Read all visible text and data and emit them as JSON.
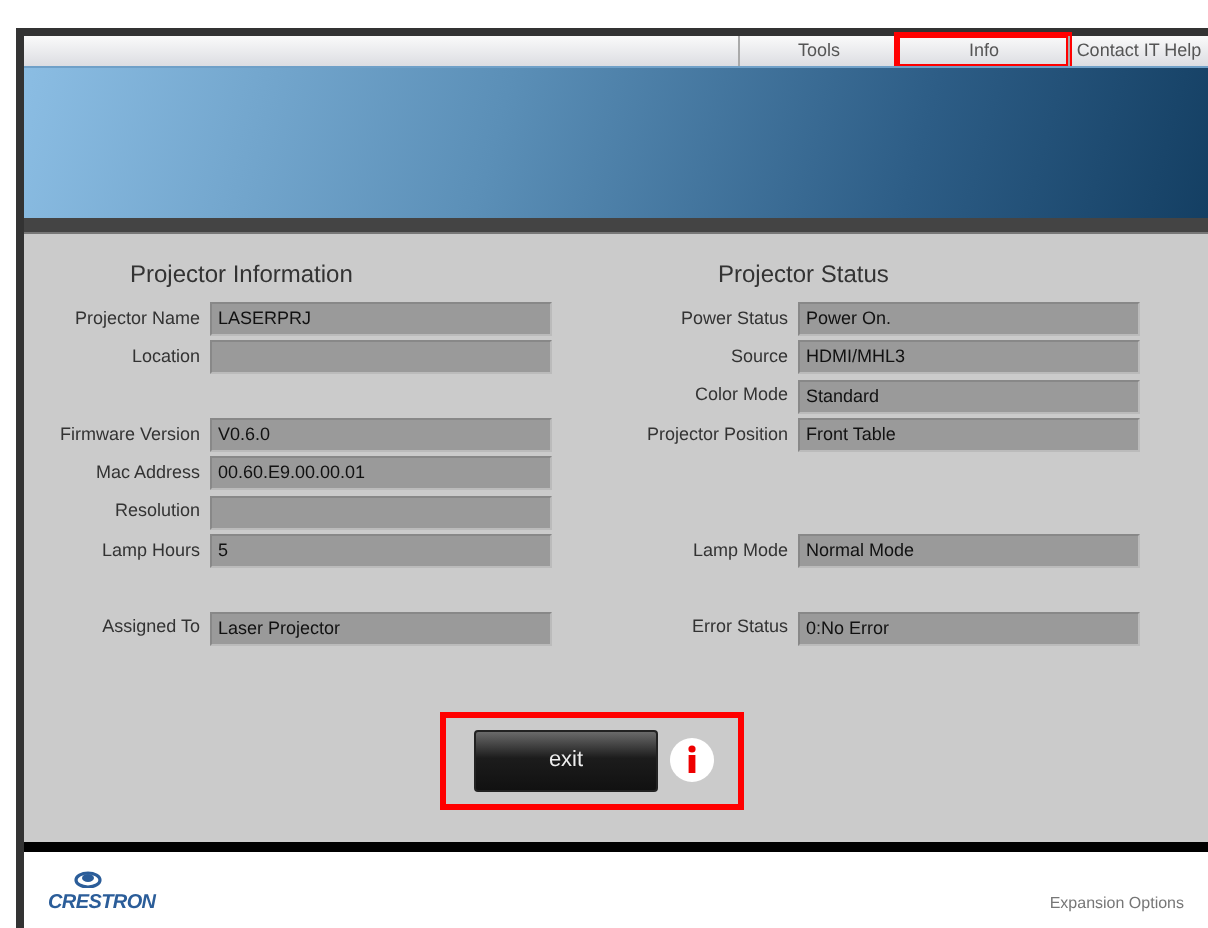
{
  "nav": [
    {
      "label": "Tools",
      "highlighted": false
    },
    {
      "label": "Info",
      "highlighted": true
    },
    {
      "label": "Contact IT Help",
      "highlighted": false
    }
  ],
  "info": {
    "title": "Projector Information",
    "rows": [
      {
        "kind": "field",
        "label": "Projector Name",
        "value": "LASERPRJ"
      },
      {
        "kind": "field",
        "label": "Location"
      },
      {
        "kind": "spacer"
      },
      {
        "kind": "field",
        "label": "Firmware Version",
        "value": "V0.6.0"
      },
      {
        "kind": "field",
        "label": "Mac Address",
        "value": "00.60.E9.00.00.01"
      },
      {
        "kind": "field",
        "label": "Resolution"
      },
      {
        "kind": "field",
        "label": "Lamp Hours",
        "value": "5"
      },
      {
        "kind": "spacer"
      },
      {
        "kind": "field",
        "label": "Assigned To",
        "value": "Laser Projector"
      }
    ]
  },
  "status": {
    "title": "Projector Status",
    "rows": [
      {
        "kind": "field",
        "label": "Power Status",
        "value": "Power On."
      },
      {
        "kind": "field",
        "label": "Source",
        "value": "HDMI/MHL3"
      },
      {
        "kind": "field",
        "label": "Color Mode",
        "value": "Standard"
      },
      {
        "kind": "field",
        "label": "Projector Position",
        "value": "Front Table"
      },
      {
        "kind": "spacer"
      },
      {
        "kind": "spacer"
      },
      {
        "kind": "field",
        "label": "Lamp Mode",
        "value": "Normal Mode"
      },
      {
        "kind": "spacer"
      },
      {
        "kind": "field",
        "label": "Error Status",
        "value": "0:No Error"
      }
    ]
  },
  "exit": {
    "label": "exit",
    "highlighted": true
  },
  "footer": {
    "logo_text": "CRESTRON",
    "link": "Expansion Options"
  }
}
